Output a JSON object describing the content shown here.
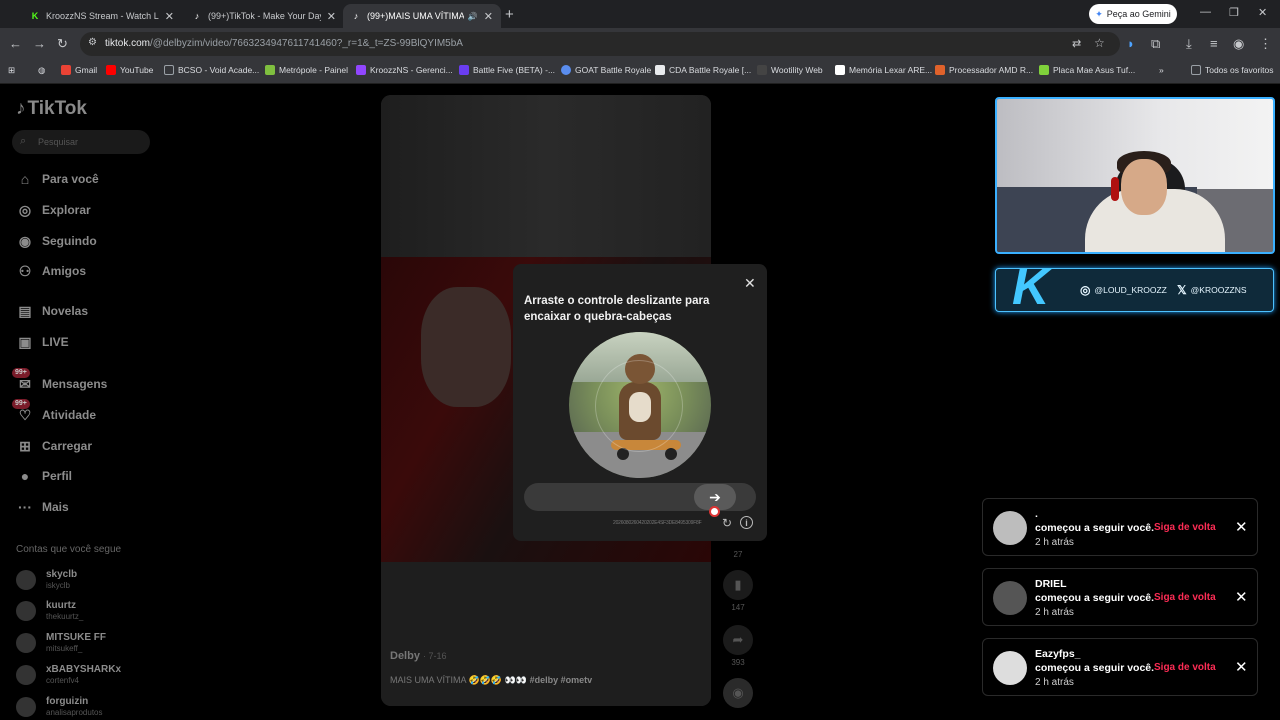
{
  "browser": {
    "tabs": [
      {
        "title": "KroozzNS Stream - Watch Live",
        "favicon": "kick-icon",
        "active": false
      },
      {
        "title": "(99+)TikTok - Make Your Day",
        "favicon": "tiktok-icon",
        "active": false
      },
      {
        "title": "(99+)MAIS UMA VÍTIMA",
        "favicon": "tiktok-icon",
        "active": true
      }
    ],
    "gemini_label": "Peça ao Gemini",
    "url_host": "tiktok.com",
    "url_path": "/@delbyzim/video/7663234947611741460?_r=1&_t=ZS-99BlQYIM5bA",
    "bookmarks": [
      {
        "label": "Gmail",
        "color": "#ea4335"
      },
      {
        "label": "YouTube",
        "color": "#ff0000"
      },
      {
        "label": "BCSO - Void Acade...",
        "color": "#9aa0a6"
      },
      {
        "label": "Metrópole - Painel",
        "color": "#7fbf3f"
      },
      {
        "label": "KroozzNS - Gerenci...",
        "color": "#9146ff"
      },
      {
        "label": "Battle Five (BETA) -...",
        "color": "#6a3df0"
      },
      {
        "label": "GOAT Battle Royale",
        "color": "#5a8dee"
      },
      {
        "label": "CDA Battle Royale [...",
        "color": "#e8eaed"
      },
      {
        "label": "Wootility Web",
        "color": "#444"
      },
      {
        "label": "Memória Lexar ARE...",
        "color": "#ffffff"
      },
      {
        "label": "Processador AMD R...",
        "color": "#e0622b"
      },
      {
        "label": "Placa Mae Asus Tuf...",
        "color": "#7fd13b"
      }
    ],
    "all_favorites": "Todos os favoritos"
  },
  "sidebar": {
    "logo": "TikTok",
    "search_placeholder": "Pesquisar",
    "nav": [
      {
        "label": "Para você",
        "icon": "home-icon"
      },
      {
        "label": "Explorar",
        "icon": "compass-icon"
      },
      {
        "label": "Seguindo",
        "icon": "following-icon"
      },
      {
        "label": "Amigos",
        "icon": "friends-icon"
      },
      {
        "label": "Novelas",
        "icon": "novelas-icon"
      },
      {
        "label": "LIVE",
        "icon": "live-icon"
      },
      {
        "label": "Mensagens",
        "icon": "messages-icon",
        "badge": "99+"
      },
      {
        "label": "Atividade",
        "icon": "activity-icon",
        "badge": "99+"
      },
      {
        "label": "Carregar",
        "icon": "upload-icon"
      },
      {
        "label": "Perfil",
        "icon": "profile-icon"
      },
      {
        "label": "Mais",
        "icon": "more-icon"
      }
    ],
    "following_header": "Contas que você segue",
    "following": [
      {
        "name": "skyclb",
        "handle": "iskyclb"
      },
      {
        "name": "kuurtz",
        "handle": "thekuurtz_"
      },
      {
        "name": "MITSUKE FF",
        "handle": "mitsukeff_"
      },
      {
        "name": "xBABYSHARKx",
        "handle": "cortenfv4"
      },
      {
        "name": "forguizin",
        "handle": "analisaprodutos"
      }
    ]
  },
  "video": {
    "author": "Delby",
    "date": "· 7-16",
    "caption": "MAIS UMA VÍTIMA 🤣🤣🤣 👀👀",
    "tags": "#delby #ometv",
    "counts": {
      "comments": "27",
      "saves": "147",
      "shares": "393"
    }
  },
  "captcha": {
    "title": "Arraste o controle deslizante para encaixar o quebra-cabeças",
    "id_text": "2026080260420202E4SF3DE8495309F8F"
  },
  "overlay": {
    "instagram": "@LOUD_KROOZZ",
    "twitter": "@KROOZZNS"
  },
  "notifications": [
    {
      "name": ".",
      "text": "começou a seguir você.",
      "time": "2 h atrás",
      "action": "Siga de volta"
    },
    {
      "name": "DRIEL",
      "text": "começou a seguir você.",
      "time": "2 h atrás",
      "action": "Siga de volta"
    },
    {
      "name": "Eazyfps_",
      "text": "começou a seguir você.",
      "time": "2 h atrás",
      "action": "Siga de volta"
    }
  ]
}
